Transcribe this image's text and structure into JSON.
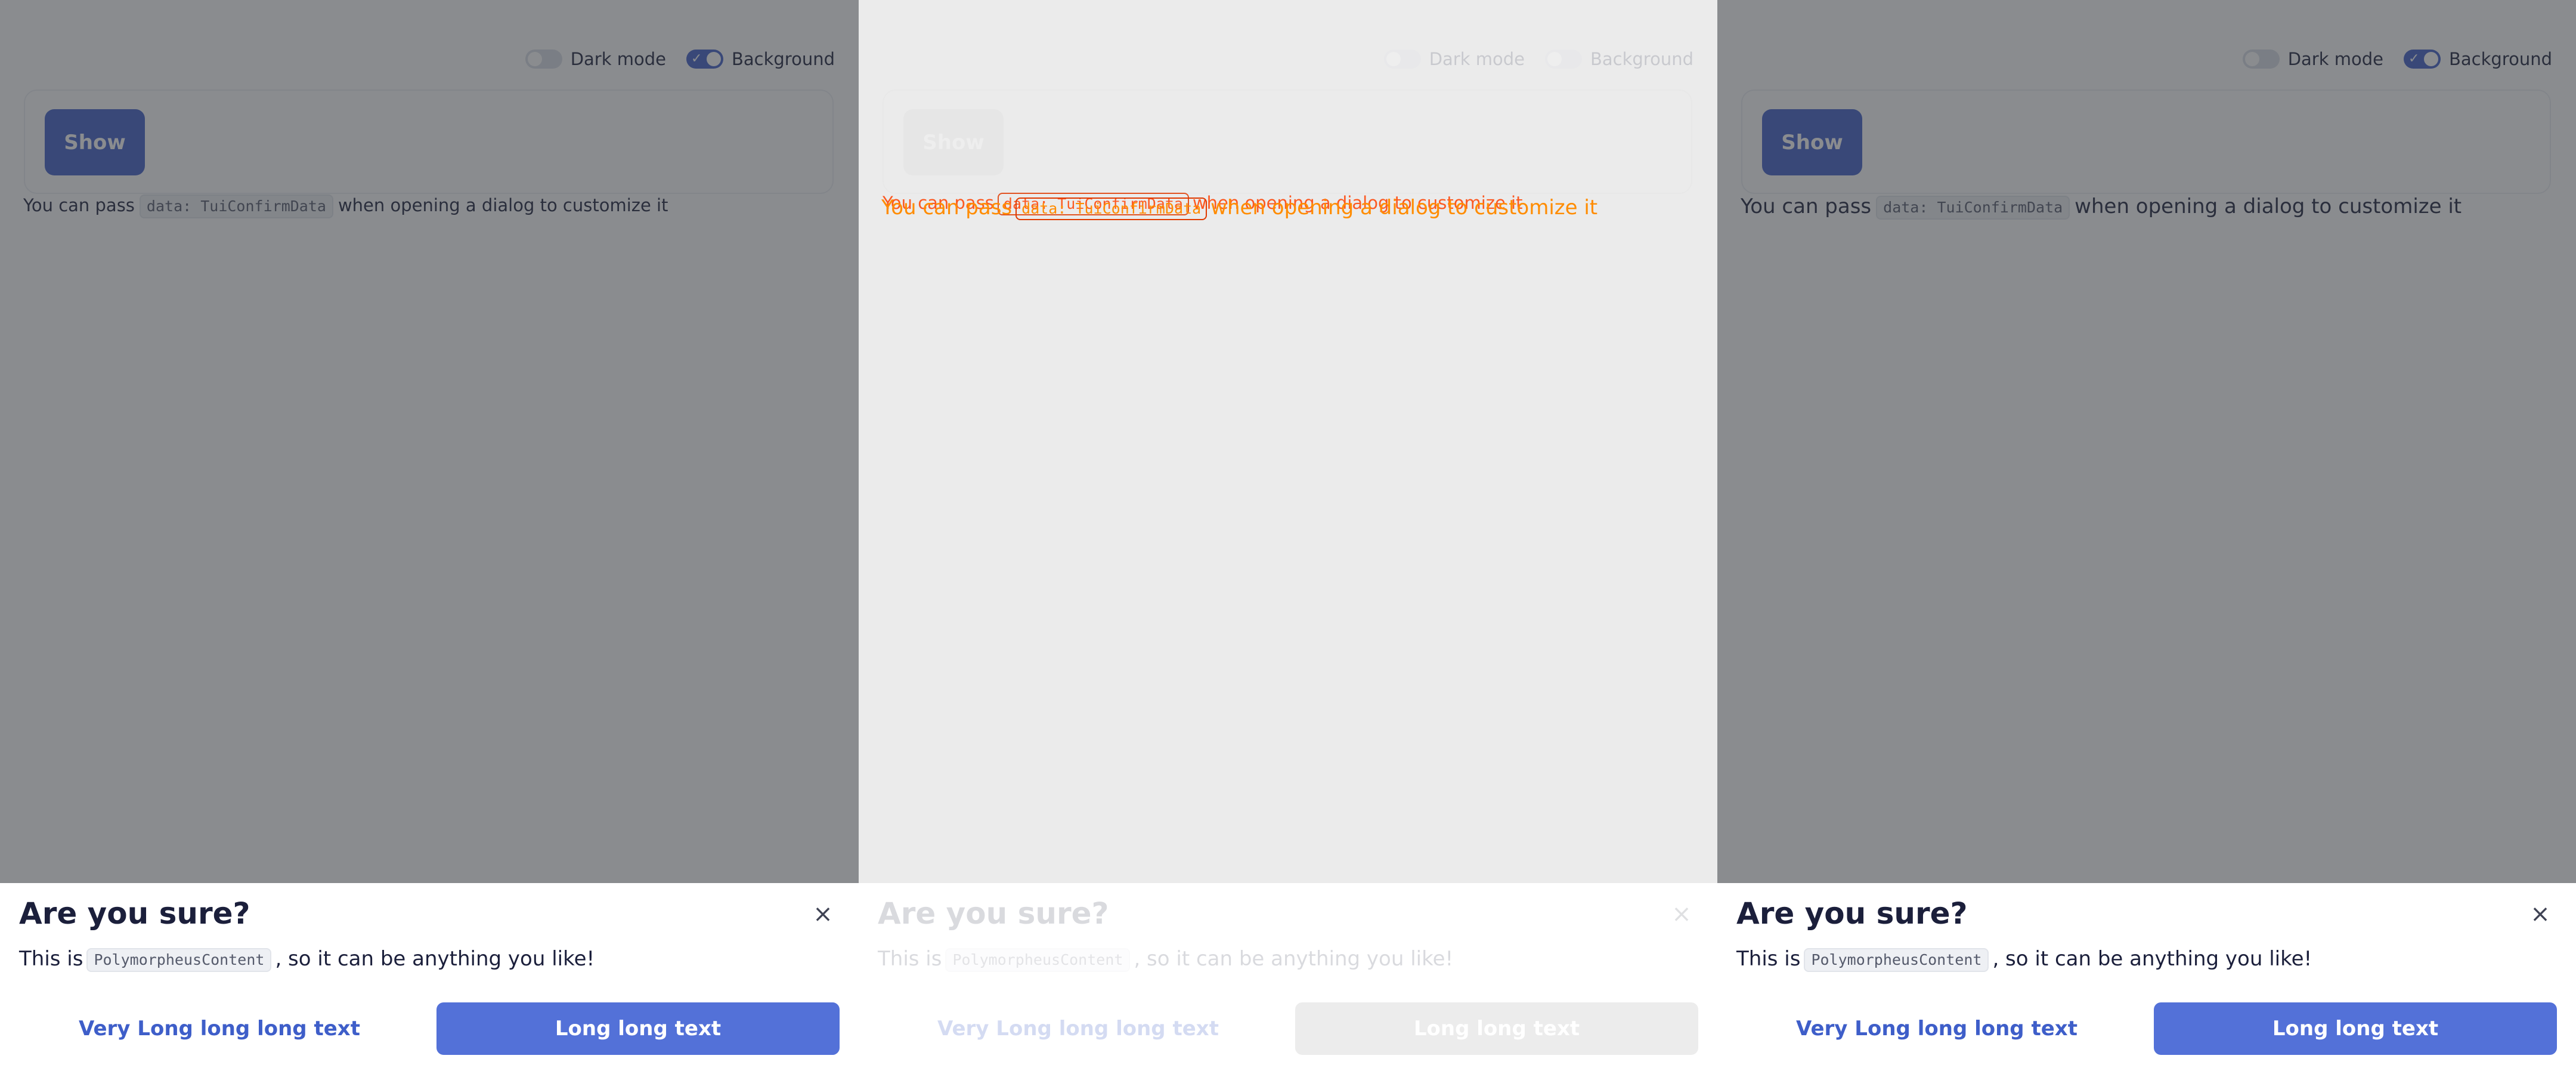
{
  "topbar": {
    "dark_mode_label": "Dark mode",
    "background_label": "Background"
  },
  "card": {
    "show_label": "Show"
  },
  "intro": {
    "before": "You can pass",
    "code": "data: TuiConfirmData",
    "after": "when opening a dialog to customize it"
  },
  "dialog": {
    "title": "Are you sure?",
    "close_glyph": "×",
    "message_before": "This is",
    "message_code": "PolymorpheusContent",
    "message_after": ", so it can be anything you like!",
    "secondary_label": "Very Long long long text",
    "primary_label": "Long long text"
  },
  "colors": {
    "accent": "#3e5ec9",
    "primary_button": "#5371d8",
    "overlay": "#36383e",
    "diff_orange": "#ff8c00",
    "diff_red": "#ff4000"
  },
  "icons": {
    "close": "close-icon",
    "check": "check-icon"
  }
}
